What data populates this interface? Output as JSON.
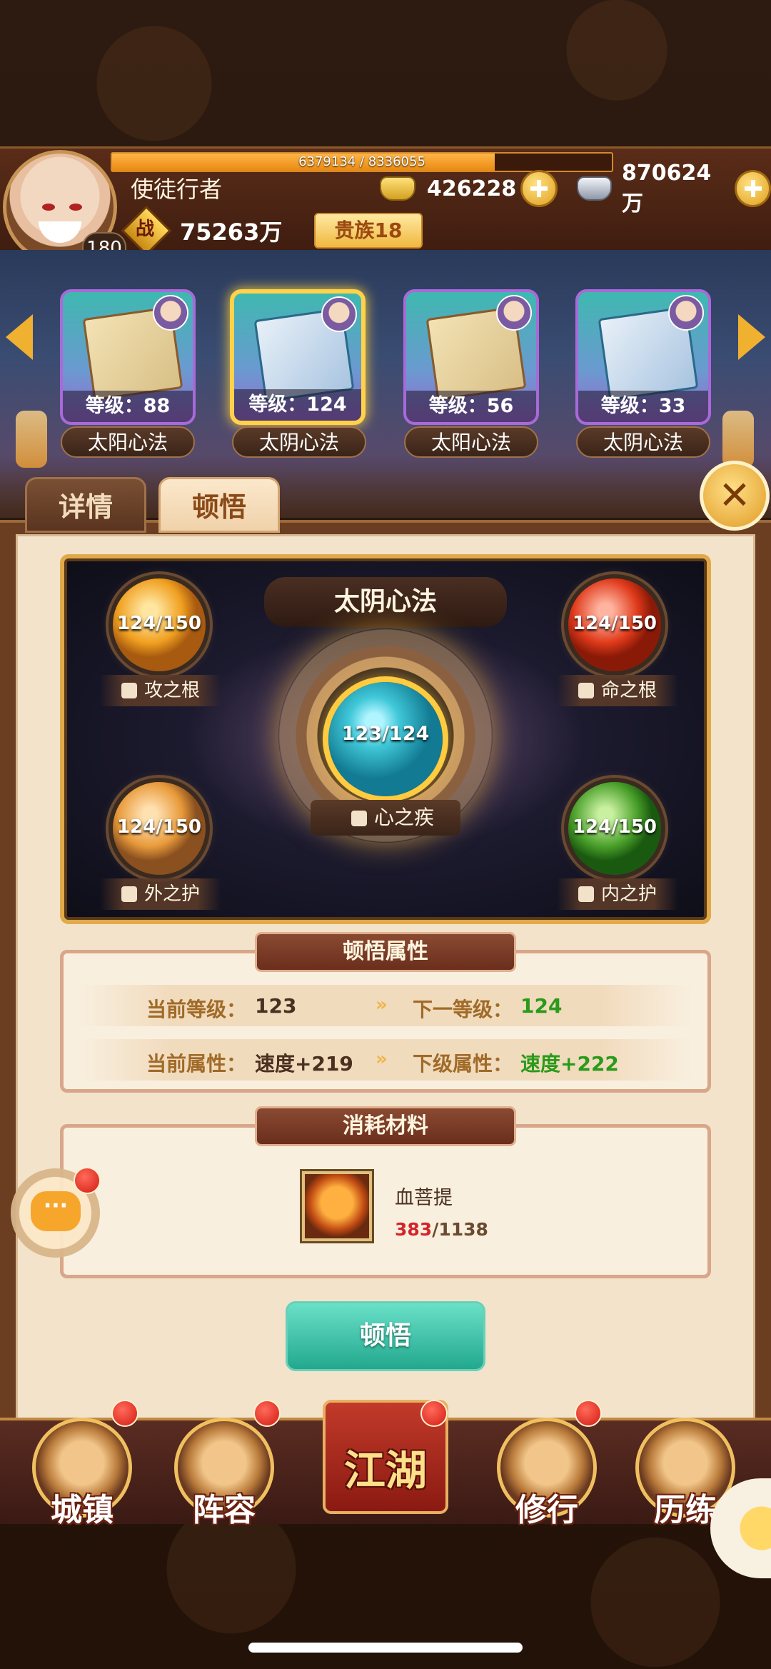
{
  "player": {
    "name": "使徒行者",
    "level": "180",
    "exp_text": "6379134 / 8336055",
    "exp_progress": 0.765,
    "power_icon_label": "战",
    "power": "75263万",
    "vip": "贵族18"
  },
  "currencies": {
    "gold": "426228",
    "silver": "870624万"
  },
  "cards": [
    {
      "level": "等级：88",
      "name": "太阳心法",
      "selected": false
    },
    {
      "level": "等级：124",
      "name": "太阴心法",
      "selected": true
    },
    {
      "level": "等级：56",
      "name": "太阳心法",
      "selected": false
    },
    {
      "level": "等级：33",
      "name": "太阴心法",
      "selected": false
    }
  ],
  "tabs": {
    "details": "详情",
    "insight": "顿悟"
  },
  "board": {
    "title": "太阴心法",
    "center": {
      "value": "123/124",
      "label": "心之疾"
    },
    "orbs": [
      {
        "value": "124/150",
        "label": "攻之根",
        "color": "#f0a020"
      },
      {
        "value": "124/150",
        "label": "命之根",
        "color": "#e03a1a"
      },
      {
        "value": "124/150",
        "label": "外之护",
        "color": "#e89a3a"
      },
      {
        "value": "124/150",
        "label": "内之护",
        "color": "#4aa02a"
      }
    ]
  },
  "attributes": {
    "title": "顿悟属性",
    "current_level_label": "当前等级：",
    "current_level": "123",
    "next_level_label": "下一等级：",
    "next_level": "124",
    "current_attr_label": "当前属性：",
    "current_attr": "速度+219",
    "next_attr_label": "下级属性：",
    "next_attr": "速度+222"
  },
  "materials": {
    "title": "消耗材料",
    "item_name": "血菩提",
    "owned": "383",
    "required": "/1138"
  },
  "action_button": "顿悟",
  "bottom_nav": [
    {
      "label": "城镇"
    },
    {
      "label": "阵容"
    },
    {
      "label": "江湖"
    },
    {
      "label": "修行"
    },
    {
      "label": "历练"
    }
  ]
}
